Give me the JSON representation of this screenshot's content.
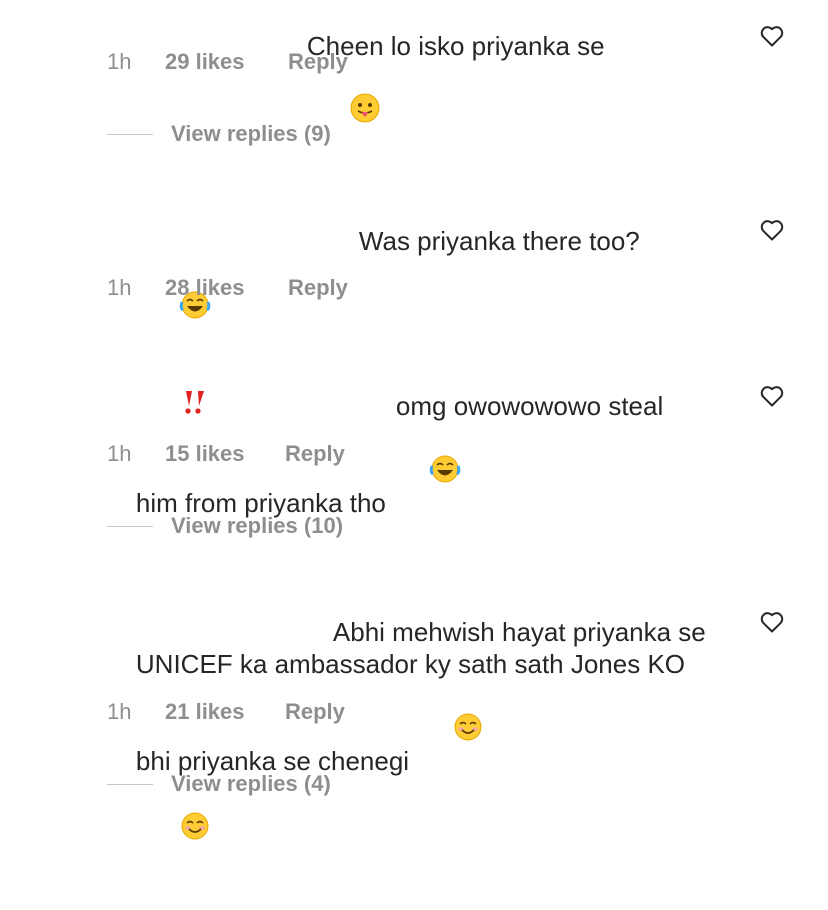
{
  "comments": [
    {
      "text_line1": "Cheen lo isko priyanka se",
      "emoji_tail": "tongue-face",
      "time": "1h",
      "likes": "29 likes",
      "reply": "Reply",
      "view_replies": "View replies (9)"
    },
    {
      "text_line1": "Was priyanka there too?",
      "emoji_line2": "laughing-face exclamation",
      "time": "1h",
      "likes": "28 likes",
      "reply": "Reply"
    },
    {
      "text_line1": "omg owowowowo steal",
      "text_line2": "him from priyanka tho",
      "emoji_tail": "laughing-face",
      "time": "1h",
      "likes": "15 likes",
      "reply": "Reply",
      "view_replies": "View replies (10)"
    },
    {
      "text_line1": "Abhi mehwish hayat priyanka se",
      "text_line2": "UNICEF ka ambassador ky sath sath Jones KO",
      "text_line3": "bhi priyanka se chenegi",
      "emoji_tail": "smiling-face smiling-face",
      "time": "1h",
      "likes": "21 likes",
      "reply": "Reply",
      "view_replies": "View replies (4)"
    }
  ],
  "icons": {
    "like": "heart-outline-icon"
  },
  "colors": {
    "text": "#262626",
    "meta": "#8e8e8e",
    "rule": "#c7c7c7"
  }
}
